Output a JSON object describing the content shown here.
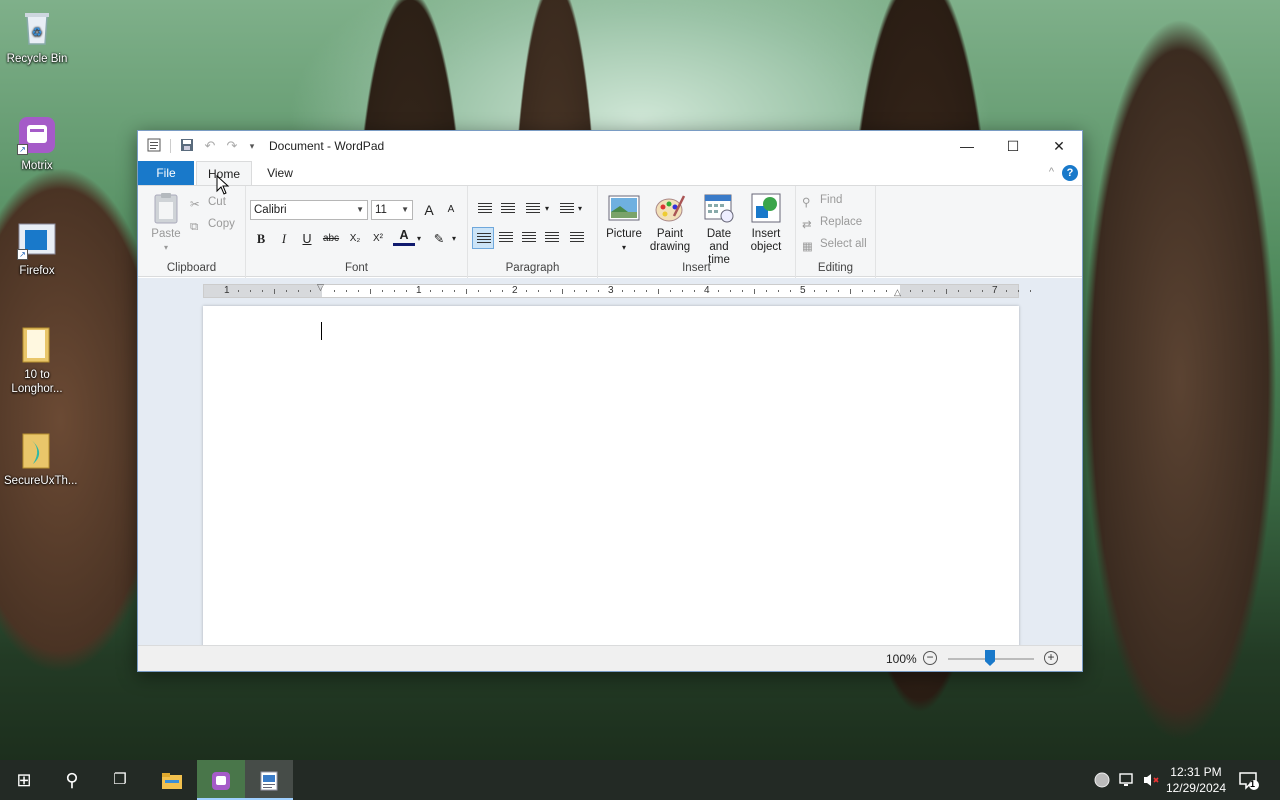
{
  "desktop": {
    "icons": [
      {
        "label": "Recycle Bin",
        "icon": "recycle-bin-icon"
      },
      {
        "label": "Motrix",
        "icon": "motrix-icon"
      },
      {
        "label": "Firefox",
        "icon": "firefox-icon"
      },
      {
        "label": "10 to Longhor...",
        "icon": "folder-icon"
      },
      {
        "label": "SecureUxTh...",
        "icon": "secureux-icon"
      }
    ]
  },
  "window": {
    "title": "Document - WordPad",
    "controls": {
      "minimize": "—",
      "maximize": "☐",
      "close": "✕"
    }
  },
  "tabs": {
    "file": "File",
    "home": "Home",
    "view": "View"
  },
  "ribbon": {
    "clipboard": {
      "label": "Clipboard",
      "paste": "Paste",
      "cut": "Cut",
      "copy": "Copy"
    },
    "font": {
      "label": "Font",
      "family": "Calibri",
      "size": "11",
      "grow": "A",
      "shrink": "A",
      "bold": "B",
      "italic": "I",
      "underline": "U",
      "strike": "abc",
      "subscript": "X₂",
      "superscript": "X²",
      "color": "A"
    },
    "paragraph": {
      "label": "Paragraph"
    },
    "insert": {
      "label": "Insert",
      "picture": "Picture",
      "paint1": "Paint",
      "paint2": "drawing",
      "date1": "Date and",
      "date2": "time",
      "object1": "Insert",
      "object2": "object"
    },
    "editing": {
      "label": "Editing",
      "find": "Find",
      "replace": "Replace",
      "select_all": "Select all"
    },
    "help": "?",
    "collapse": "^"
  },
  "ruler": {
    "numbers": [
      "1",
      "1",
      "2",
      "3",
      "4",
      "5",
      "7"
    ]
  },
  "status": {
    "zoom": "100%",
    "zoom_out": "−",
    "zoom_in": "+"
  },
  "taskbar": {
    "start": "⊞",
    "search": "⚲",
    "taskview": "❐",
    "time": "12:31 PM",
    "date": "12/29/2024",
    "notifications": "1"
  }
}
